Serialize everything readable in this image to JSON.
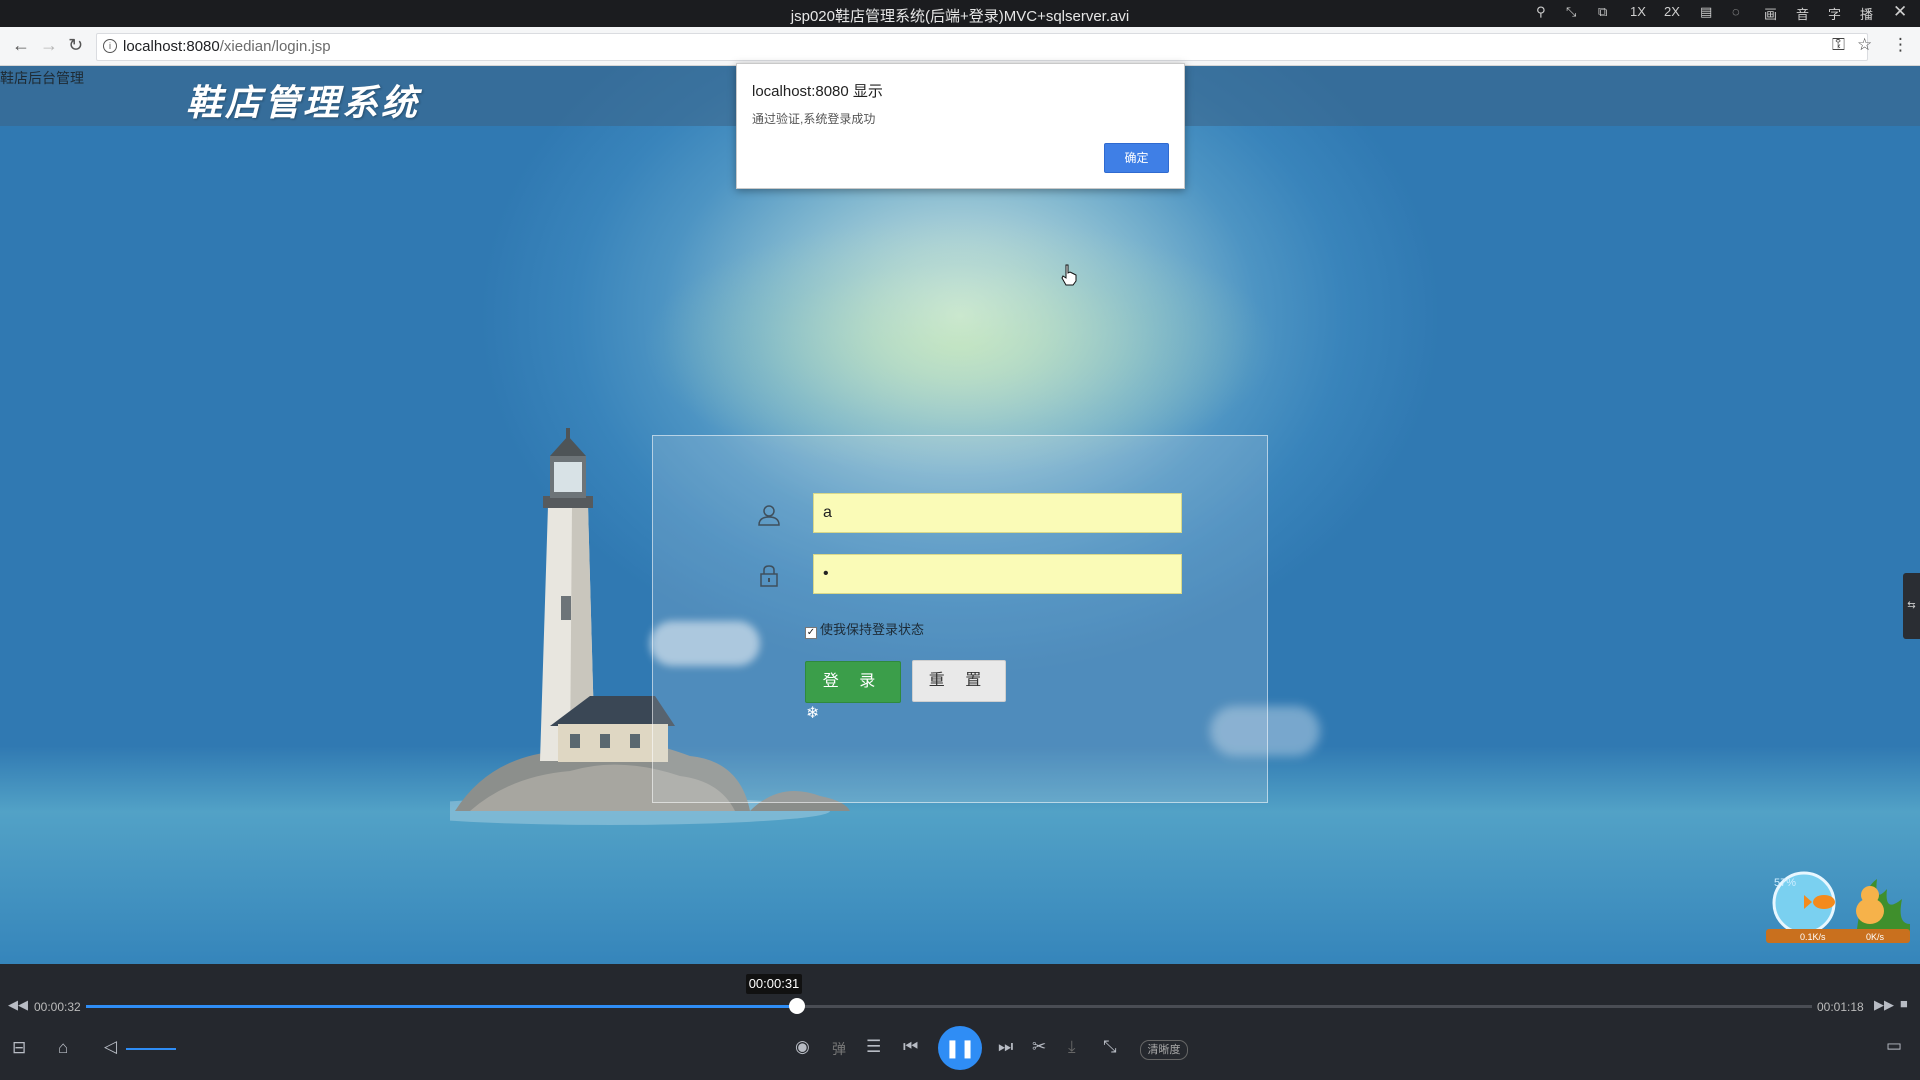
{
  "window": {
    "title": "jsp020鞋店管理系统(后端+登录)MVC+sqlserver.avi",
    "controls": [
      "1X",
      "2X",
      "画",
      "音",
      "字",
      "播"
    ]
  },
  "browser": {
    "url_host": "localhost:8080",
    "url_path": "/xiedian/login.jsp"
  },
  "page": {
    "small_label": "鞋店后台管理",
    "brand": "鞋店管理系统",
    "login": {
      "username_value": "a",
      "password_value": "•",
      "remember_label": "使我保持登录状态",
      "remember_checked": true,
      "login_button": "登 录",
      "reset_button": "重 置"
    }
  },
  "dialog": {
    "title": "localhost:8080 显示",
    "message": "通过验证,系统登录成功",
    "ok_button": "确定"
  },
  "widget": {
    "percent": "57%",
    "upload": "0.1K/s",
    "download": "0K/s"
  },
  "player": {
    "current_time": "00:00:32",
    "hover_time": "00:00:31",
    "total_time": "00:01:18",
    "progress": 0.412,
    "danmaku_label": "弹",
    "clarity_label": "清晰度",
    "accent": "#2f8df5"
  }
}
